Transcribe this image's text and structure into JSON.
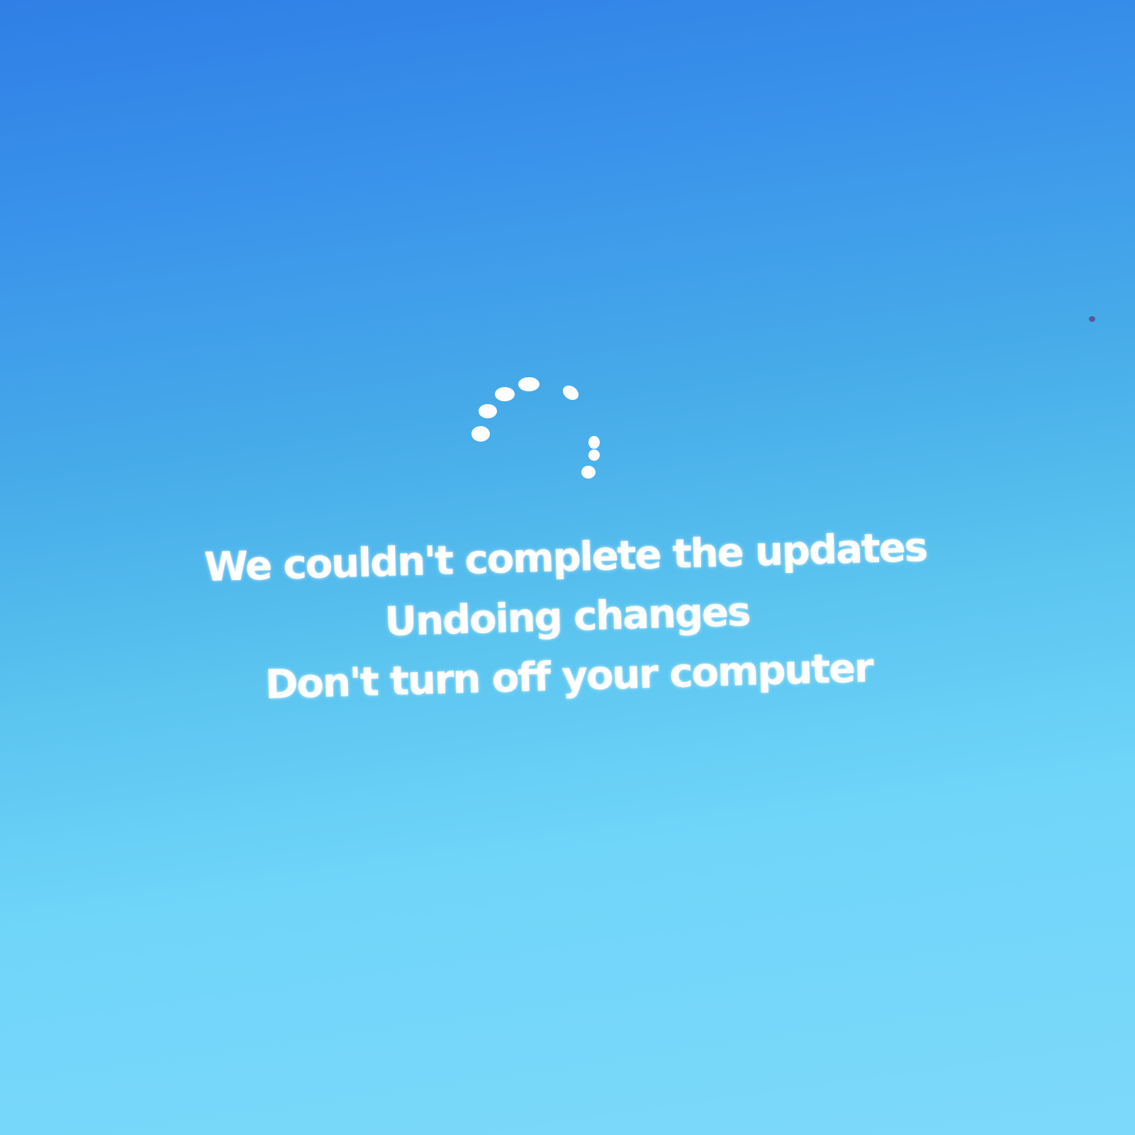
{
  "screen": {
    "background_colors": [
      "#2f7fe6",
      "#47ace9",
      "#7dd9fb"
    ],
    "text_color": "#ffffff"
  },
  "spinner": {
    "icon": "loading-dots-spinner-icon",
    "dot_color": "#ffffff"
  },
  "message": {
    "line1": "We couldn't complete the updates",
    "line2": "Undoing changes",
    "line3": "Don't turn off your computer"
  }
}
